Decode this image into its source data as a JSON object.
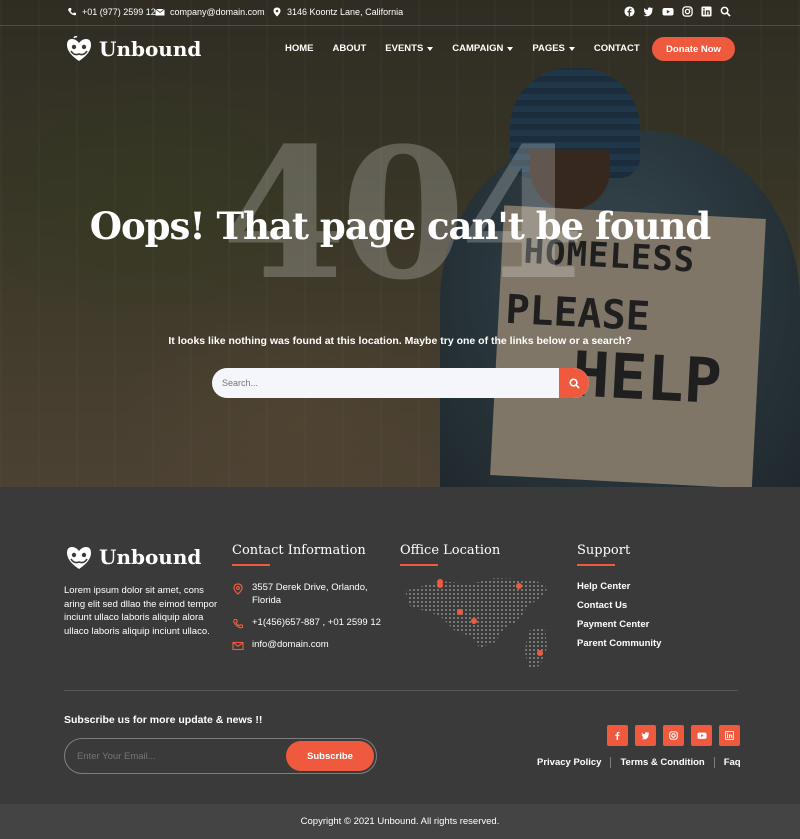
{
  "topbar": {
    "phone": "+01 (977) 2599 12",
    "email": "company@domain.com",
    "address": "3146 Koontz Lane, California",
    "social_icons": [
      "facebook-icon",
      "twitter-icon",
      "youtube-icon",
      "instagram-icon",
      "linkedin-icon",
      "search-icon"
    ]
  },
  "brand": {
    "name": "Unbound"
  },
  "nav": {
    "items": [
      {
        "label": "HOME",
        "dropdown": false
      },
      {
        "label": "ABOUT",
        "dropdown": false
      },
      {
        "label": "EVENTS",
        "dropdown": true
      },
      {
        "label": "CAMPAIGN",
        "dropdown": true
      },
      {
        "label": "PAGES",
        "dropdown": true
      },
      {
        "label": "CONTACT",
        "dropdown": false
      }
    ],
    "donate_label": "Donate Now"
  },
  "hero": {
    "code": "404",
    "title": "Oops! That page can't be found",
    "subtitle": "It looks like nothing was found at this location. Maybe try one of the links below or a search?",
    "search_placeholder": "Search...",
    "sign_lines": [
      "HOMELESS",
      "PLEASE",
      "HELP"
    ]
  },
  "footer": {
    "about": "Lorem ipsum dolor sit amet, cons aring elit sed dllao the eimod tempor inciunt ullaco laboris aliquip alora ullaco laboris aliquip inciunt ullaco.",
    "contact_heading": "Contact Information",
    "contact_address": "3557 Derek Drive, Orlando, Florida",
    "contact_phone": "+1(456)657-887 , +01 2599 12",
    "contact_email": "info@domain.com",
    "office_heading": "Office Location",
    "support_heading": "Support",
    "support_links": [
      "Help Center",
      "Contact Us",
      "Payment Center",
      "Parent Community"
    ],
    "subscribe_title": "Subscribe us for more update & news !!",
    "subscribe_placeholder": "Enter Your Email...",
    "subscribe_button": "Subscribe",
    "social_icons": [
      "facebook-icon",
      "twitter-icon",
      "instagram-icon",
      "youtube-icon",
      "linkedin-icon"
    ],
    "legal_links": [
      "Privacy Policy",
      "Terms & Condition",
      "Faq"
    ],
    "copyright": "Copyright © 2021 Unbound. All rights reserved."
  },
  "colors": {
    "accent": "#ef5a3f",
    "footer_bg": "#3a3a3a",
    "copyright_bg": "#444444"
  }
}
